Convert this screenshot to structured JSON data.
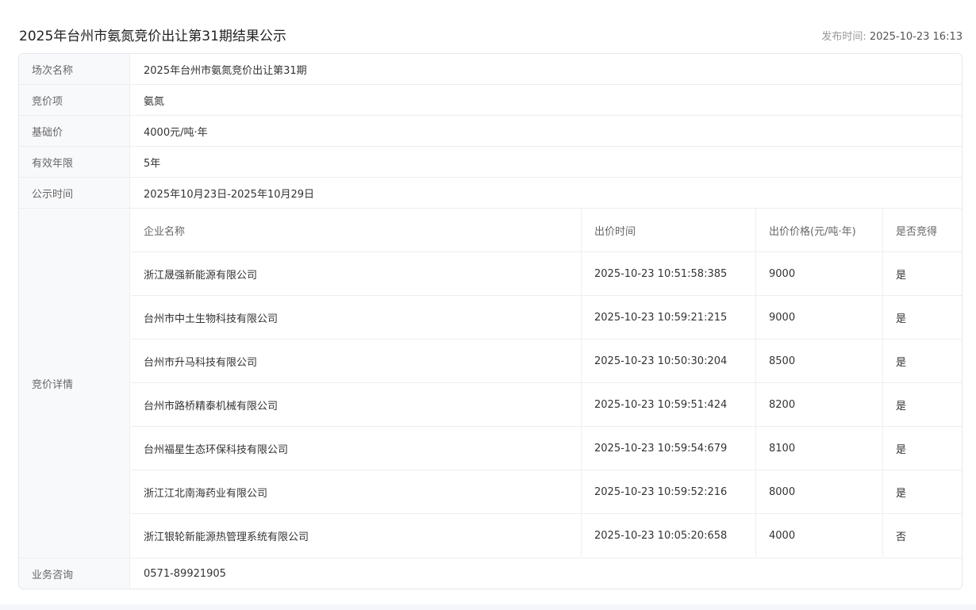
{
  "title": "2025年台州市氨氮竞价出让第31期结果公示",
  "publish": {
    "label": "发布时间:",
    "value": "2025-10-23 16:13"
  },
  "fields": [
    {
      "label": "场次名称",
      "value": "2025年台州市氨氮竞价出让第31期"
    },
    {
      "label": "竞价项",
      "value": "氨氮"
    },
    {
      "label": "基础价",
      "value": "4000元/吨·年"
    },
    {
      "label": "有效年限",
      "value": "5年"
    },
    {
      "label": "公示时间",
      "value": "2025年10月23日-2025年10月29日"
    }
  ],
  "bids": {
    "label": "竞价详情",
    "headers": [
      "企业名称",
      "出价时间",
      "出价价格(元/吨·年)",
      "是否竞得"
    ],
    "rows": [
      [
        "浙江晟强新能源有限公司",
        "2025-10-23 10:51:58:385",
        "9000",
        "是"
      ],
      [
        "台州市中土生物科技有限公司",
        "2025-10-23 10:59:21:215",
        "9000",
        "是"
      ],
      [
        "台州市升马科技有限公司",
        "2025-10-23 10:50:30:204",
        "8500",
        "是"
      ],
      [
        "台州市路桥精泰机械有限公司",
        "2025-10-23 10:59:51:424",
        "8200",
        "是"
      ],
      [
        "台州福星生态环保科技有限公司",
        "2025-10-23 10:59:54:679",
        "8100",
        "是"
      ],
      [
        "浙江江北南海药业有限公司",
        "2025-10-23 10:59:52:216",
        "8000",
        "是"
      ],
      [
        "浙江银轮新能源热管理系统有限公司",
        "2025-10-23 10:05:20:658",
        "4000",
        "否"
      ]
    ]
  },
  "consult": {
    "label": "业务咨询",
    "value": "0571-89921905"
  }
}
